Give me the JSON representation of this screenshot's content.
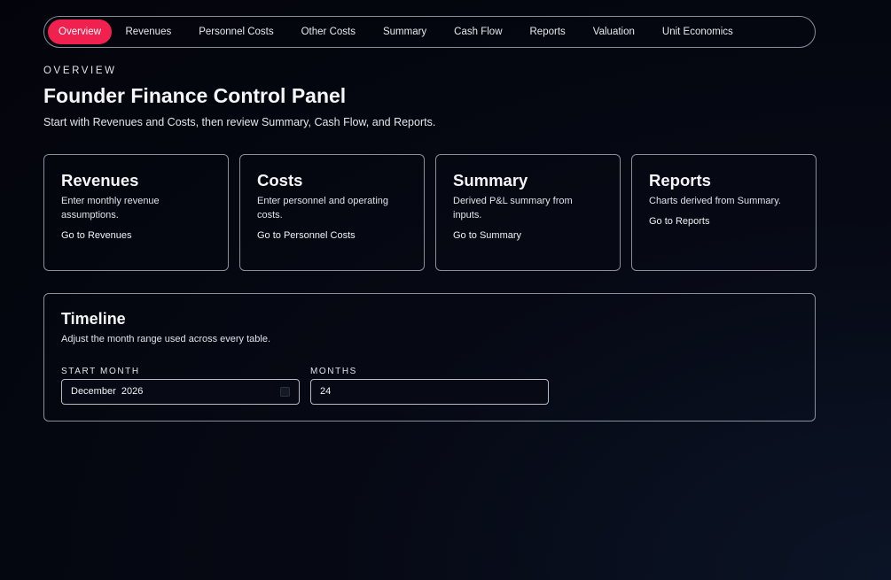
{
  "nav": {
    "items": [
      {
        "label": "Overview",
        "active": true
      },
      {
        "label": "Revenues"
      },
      {
        "label": "Personnel Costs"
      },
      {
        "label": "Other Costs"
      },
      {
        "label": "Summary"
      },
      {
        "label": "Cash Flow"
      },
      {
        "label": "Reports"
      },
      {
        "label": "Valuation"
      },
      {
        "label": "Unit Economics"
      }
    ]
  },
  "header": {
    "eyebrow": "OVERVIEW",
    "title": "Founder Finance Control Panel",
    "subtitle": "Start with Revenues and Costs, then review Summary, Cash Flow, and Reports."
  },
  "cards": [
    {
      "title": "Revenues",
      "description": "Enter monthly revenue assumptions.",
      "link": "Go to Revenues"
    },
    {
      "title": "Costs",
      "description": "Enter personnel and operating costs.",
      "link": "Go to Personnel Costs"
    },
    {
      "title": "Summary",
      "description": "Derived P&L summary from inputs.",
      "link": "Go to Summary"
    },
    {
      "title": "Reports",
      "description": "Charts derived from Summary.",
      "link": "Go to Reports"
    }
  ],
  "timeline": {
    "title": "Timeline",
    "description": "Adjust the month range used across every table.",
    "start_month_label": "START MONTH",
    "start_month_value": "December  2026",
    "months_label": "MONTHS",
    "months_value": "24"
  },
  "colors": {
    "accent": "#f0204f",
    "background": "#03040b",
    "border": "#8a8f9c"
  }
}
